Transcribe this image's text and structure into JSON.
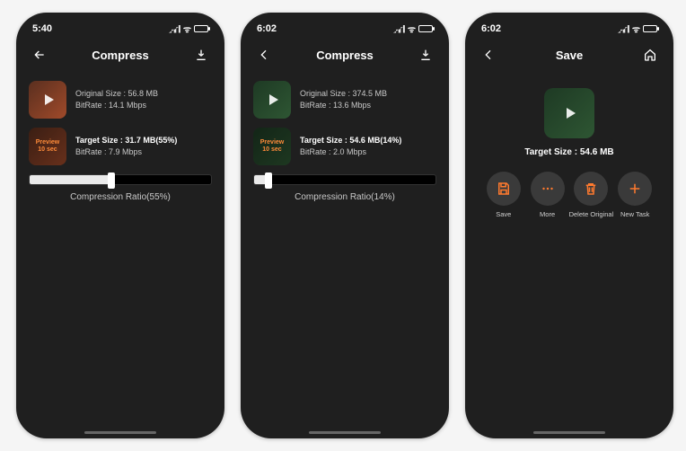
{
  "screens": [
    {
      "time": "5:40",
      "title": "Compress",
      "nav_left": "back",
      "nav_right": "download",
      "original": {
        "size_label": "Original Size : 56.8 MB",
        "bitrate_label": "BitRate : 14.1 Mbps"
      },
      "target": {
        "preview_label": "Preview",
        "preview_sub": "10 sec",
        "size_label": "Target Size : 31.7 MB(55%)",
        "bitrate_label": "BitRate : 7.9 Mbps"
      },
      "ratio_label": "Compression Ratio(55%)",
      "ratio_pct": 45,
      "thumb_variant": "brown"
    },
    {
      "time": "6:02",
      "title": "Compress",
      "nav_left": "back-chevron",
      "nav_right": "download",
      "original": {
        "size_label": "Original Size : 374.5 MB",
        "bitrate_label": "BitRate : 13.6 Mbps"
      },
      "target": {
        "preview_label": "Preview",
        "preview_sub": "10 sec",
        "size_label": "Target Size : 54.6 MB(14%)",
        "bitrate_label": "BitRate : 2.0 Mbps"
      },
      "ratio_label": "Compression Ratio(14%)",
      "ratio_pct": 8,
      "thumb_variant": "green"
    },
    {
      "time": "6:02",
      "title": "Save",
      "nav_left": "back-chevron",
      "nav_right": "home",
      "target_size_label": "Target Size : 54.6 MB",
      "thumb_variant": "green",
      "actions": [
        {
          "key": "save",
          "label": "Save",
          "icon": "save"
        },
        {
          "key": "more",
          "label": "More",
          "icon": "more"
        },
        {
          "key": "delete",
          "label": "Delete Original",
          "icon": "trash"
        },
        {
          "key": "newtask",
          "label": "New Task",
          "icon": "plus"
        }
      ]
    }
  ]
}
